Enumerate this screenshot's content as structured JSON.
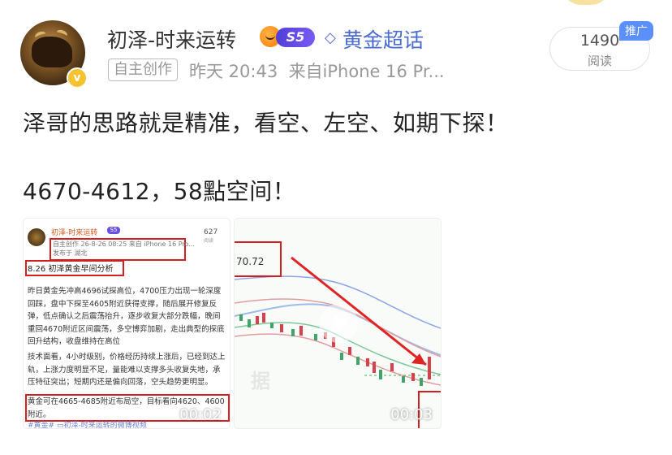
{
  "post": {
    "author": "初泽-时来运转",
    "level_badge": "S5",
    "topic_label": "黄金超话",
    "self_tag": "自主创作",
    "time": "昨天 20:43",
    "source": "来自iPhone 16 Pr...",
    "views": "1490",
    "views_label": "阅读",
    "promo": "推广",
    "text_line1": "泽哥的思路就是精准，看空、左空、如期下探！",
    "text_line2": "4670-4612，58點空间！"
  },
  "thumb1": {
    "author": "初泽-时来运转",
    "badge": "S5",
    "views": "627",
    "views_label": "阅读",
    "meta": "自主创作  26-8-26 08:25  来自 iPhone 16 Pro...",
    "location": "发布于 湖北",
    "title": "8.26 初泽黄金早间分析",
    "para1": "昨日黄金先冲高4696试探高位，4700压力出现一轮深度回踩，盘中下探至4605附近获得支撑，随后展开修复反弹，低点确认之后震荡抬升，逐步收复大部分跌幅，晚间重回4670附近区间震荡，多空博弈加剧，走出典型的探底回升结构，收盘维持在高位",
    "para2": "技术面看，4小时级别，价格经历持续上涨后，已经到达上轨，上涨力度明显不足，量能难以支撑多头收复失地，承压特征突出；短期内还是偏向回落，空头趋势更明显。",
    "para3": "黄金可在4665-4685附近布局空，目标看向4620、4600附近。",
    "tags": "#黄金# ▭初泽-时来运转的微博视频",
    "duration": "00:02"
  },
  "thumb2": {
    "price_label": "70.72",
    "duration": "00:03",
    "watermark": "据"
  },
  "colors": {
    "link": "#4b6bcf",
    "accent_red": "#d02020",
    "badge_purple": "#5b49d8",
    "promo_blue": "#5b8ff9"
  }
}
